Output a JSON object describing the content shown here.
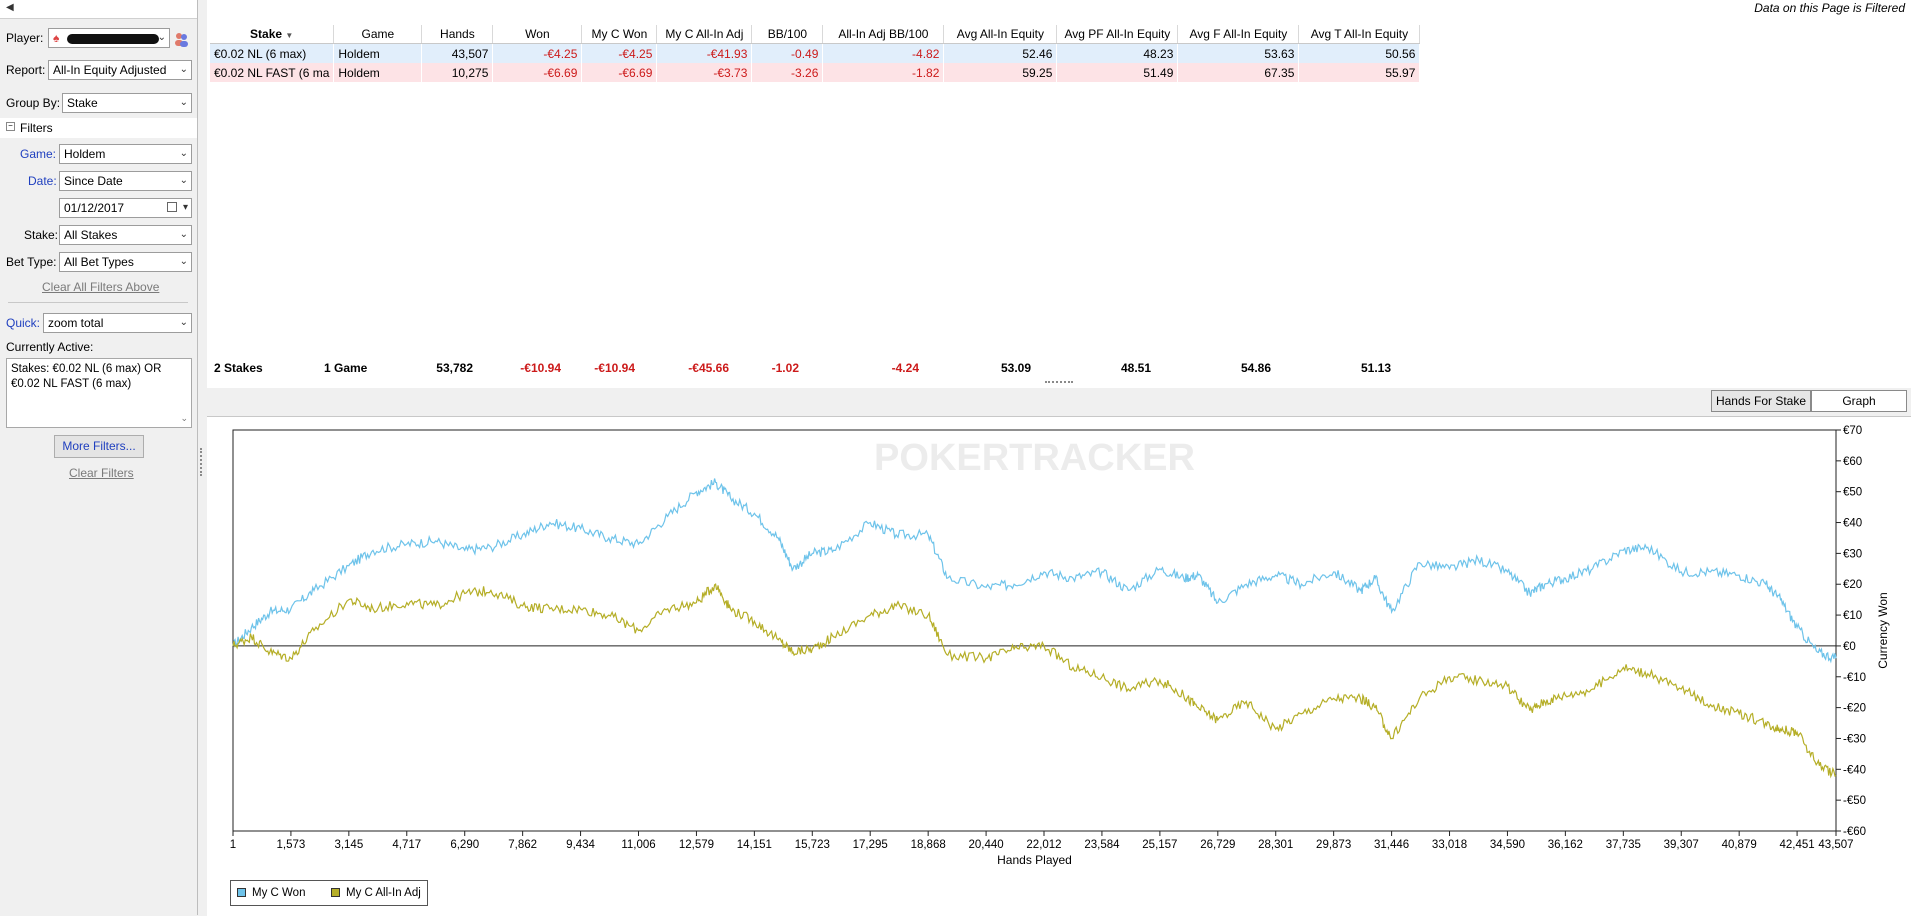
{
  "sidebar": {
    "player_label": "Player:",
    "report_label": "Report:",
    "report_value": "All-In Equity Adjusted",
    "groupby_label": "Group By:",
    "groupby_value": "Stake",
    "filters_header": "Filters",
    "game_label": "Game:",
    "game_value": "Holdem",
    "date_label": "Date:",
    "date_value": "Since Date",
    "date_input": "01/12/2017",
    "stake_label": "Stake:",
    "stake_value": "All Stakes",
    "bettype_label": "Bet Type:",
    "bettype_value": "All Bet Types",
    "clear_above": "Clear All Filters Above",
    "quick_label": "Quick:",
    "quick_value": "zoom total",
    "currently_active_label": "Currently Active:",
    "currently_active_text": "Stakes: €0.02 NL (6 max) OR €0.02 NL FAST (6 max)",
    "more_filters": "More Filters...",
    "clear_filters": "Clear Filters"
  },
  "header": {
    "filtered_notice": "Data on this Page is Filtered"
  },
  "table": {
    "columns": [
      "Stake",
      "Game",
      "Hands",
      "Won",
      "My C Won",
      "My C All-In Adj",
      "BB/100",
      "All-In Adj BB/100",
      "Avg All-In Equity",
      "Avg PF All-In Equity",
      "Avg F All-In Equity",
      "Avg T All-In Equity"
    ],
    "rows": [
      [
        "€0.02 NL (6 max)",
        "Holdem",
        "43,507",
        "-€4.25",
        "-€4.25",
        "-€41.93",
        "-0.49",
        "-4.82",
        "52.46",
        "48.23",
        "53.63",
        "50.56"
      ],
      [
        "€0.02 NL FAST (6 ma",
        "Holdem",
        "10,275",
        "-€6.69",
        "-€6.69",
        "-€3.73",
        "-3.26",
        "-1.82",
        "59.25",
        "51.49",
        "67.35",
        "55.97"
      ]
    ],
    "totals": [
      "2 Stakes",
      "1 Game",
      "53,782",
      "-€10.94",
      "-€10.94",
      "-€45.66",
      "-1.02",
      "-4.24",
      "53.09",
      "48.51",
      "54.86",
      "51.13"
    ]
  },
  "tabs": {
    "hands_for_stake": "Hands For Stake",
    "graph": "Graph"
  },
  "chart_data": {
    "type": "line",
    "watermark": "POKERTRACKER",
    "xlabel": "Hands Played",
    "ylabel": "Currency Won",
    "xlim": [
      1,
      43507
    ],
    "ylim": [
      -60,
      70
    ],
    "x_ticks": [
      "1",
      "1,573",
      "3,145",
      "4,717",
      "6,290",
      "7,862",
      "9,434",
      "11,006",
      "12,579",
      "14,151",
      "15,723",
      "17,295",
      "18,868",
      "20,440",
      "22,012",
      "23,584",
      "25,157",
      "26,729",
      "28,301",
      "29,873",
      "31,446",
      "33,018",
      "34,590",
      "36,162",
      "37,735",
      "39,307",
      "40,879",
      "42,451",
      "43,507"
    ],
    "x_tick_values": [
      1,
      1573,
      3145,
      4717,
      6290,
      7862,
      9434,
      11006,
      12579,
      14151,
      15723,
      17295,
      18868,
      20440,
      22012,
      23584,
      25157,
      26729,
      28301,
      29873,
      31446,
      33018,
      34590,
      36162,
      37735,
      39307,
      40879,
      42451,
      43507
    ],
    "y_ticks": [
      "€70",
      "€60",
      "€50",
      "€40",
      "€30",
      "€20",
      "€10",
      "€0",
      "-€10",
      "-€20",
      "-€30",
      "-€40",
      "-€50",
      "-€60"
    ],
    "y_tick_values": [
      70,
      60,
      50,
      40,
      30,
      20,
      10,
      0,
      -10,
      -20,
      -30,
      -40,
      -50,
      -60
    ],
    "series": [
      {
        "name": "My C Won",
        "color": "#6ec3ea",
        "x": [
          1,
          500,
          1000,
          1573,
          2200,
          3145,
          3800,
          4717,
          5500,
          6290,
          7000,
          7862,
          8600,
          9434,
          10200,
          11006,
          11800,
          12579,
          13100,
          13500,
          14151,
          14800,
          15200,
          15723,
          16300,
          17295,
          18000,
          18868,
          19400,
          20440,
          21200,
          22012,
          22800,
          23584,
          24300,
          25157,
          25800,
          26200,
          26729,
          27500,
          28301,
          29000,
          29873,
          30600,
          31000,
          31446,
          32200,
          33018,
          33800,
          34590,
          35200,
          35600,
          36162,
          36900,
          37735,
          38400,
          39307,
          40100,
          40879,
          41600,
          42000,
          42451,
          43000,
          43507
        ],
        "y": [
          0,
          6,
          11,
          12,
          18,
          26,
          31,
          33,
          34,
          31,
          32,
          36,
          40,
          38,
          35,
          33,
          42,
          50,
          53,
          48,
          43,
          35,
          25,
          30,
          31,
          40,
          36,
          36,
          22,
          19,
          20,
          24,
          22,
          24,
          18,
          25,
          22,
          23,
          14,
          20,
          23,
          20,
          24,
          18,
          22,
          11,
          27,
          25,
          28,
          24,
          17,
          20,
          22,
          25,
          31,
          32,
          24,
          24,
          23,
          20,
          15,
          6,
          -2,
          -4
        ]
      },
      {
        "name": "My C All-In Adj",
        "color": "#b5ae27",
        "x": [
          1,
          500,
          1000,
          1573,
          2200,
          3145,
          3800,
          4717,
          5500,
          6290,
          7000,
          7862,
          8600,
          9434,
          10200,
          11006,
          11800,
          12579,
          13100,
          13500,
          14151,
          14800,
          15200,
          15723,
          16300,
          17295,
          18000,
          18868,
          19400,
          20440,
          21200,
          22012,
          22800,
          23584,
          24300,
          25157,
          25800,
          26200,
          26729,
          27500,
          28301,
          29000,
          29873,
          30600,
          31000,
          31446,
          32200,
          33018,
          33800,
          34590,
          35200,
          35600,
          36162,
          36900,
          37735,
          38400,
          39307,
          40100,
          40879,
          41600,
          42000,
          42451,
          43000,
          43507
        ],
        "y": [
          0,
          3,
          -2,
          -4,
          5,
          15,
          12,
          14,
          13,
          17,
          18,
          13,
          12,
          12,
          10,
          5,
          12,
          14,
          20,
          12,
          8,
          2,
          -2,
          -1,
          3,
          10,
          13,
          10,
          -3,
          -4,
          -1,
          0,
          -7,
          -10,
          -14,
          -11,
          -16,
          -20,
          -24,
          -18,
          -27,
          -22,
          -17,
          -17,
          -20,
          -30,
          -17,
          -10,
          -11,
          -13,
          -21,
          -18,
          -16,
          -14,
          -7,
          -9,
          -14,
          -19,
          -22,
          -25,
          -27,
          -28,
          -38,
          -42
        ]
      }
    ],
    "legend": {
      "position": "bottom-left",
      "items": [
        "My C Won",
        "My C All-In Adj"
      ]
    }
  }
}
